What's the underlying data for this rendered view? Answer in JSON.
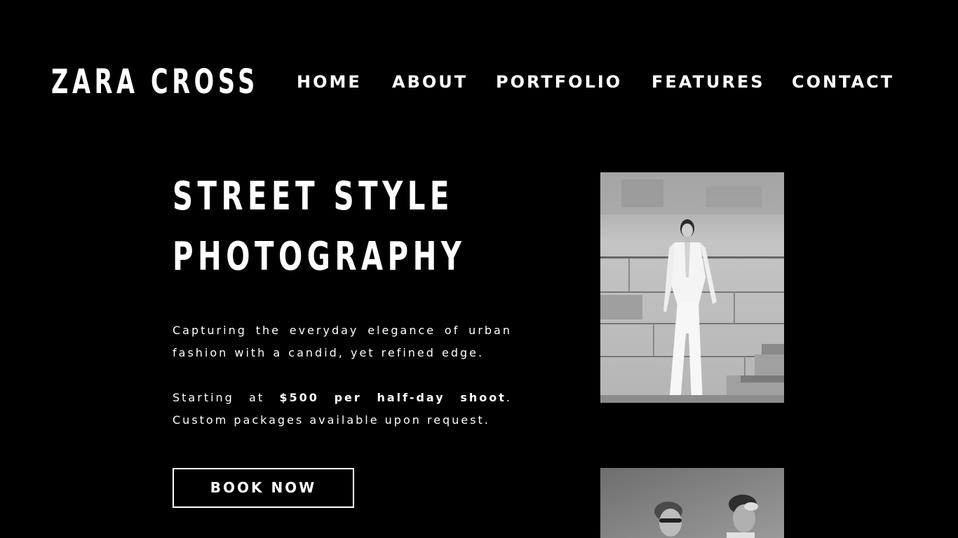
{
  "site": {
    "logo": "ZARA CROSS"
  },
  "nav": {
    "items": [
      "HOME",
      "ABOUT",
      "PORTFOLIO",
      "FEATURES",
      "CONTACT"
    ]
  },
  "hero": {
    "title_line1": "STREET STYLE",
    "title_line2": "PHOTOGRAPHY",
    "description": "Capturing the everyday elegance of urban fashion with a candid, yet refined edge.",
    "pricing_prefix": "Starting at ",
    "pricing_bold": "$500 per half-day shoot",
    "pricing_suffix": ". Custom packages available upon request.",
    "cta_label": "BOOK NOW"
  },
  "colors": {
    "background": "#000000",
    "text": "#ffffff"
  }
}
